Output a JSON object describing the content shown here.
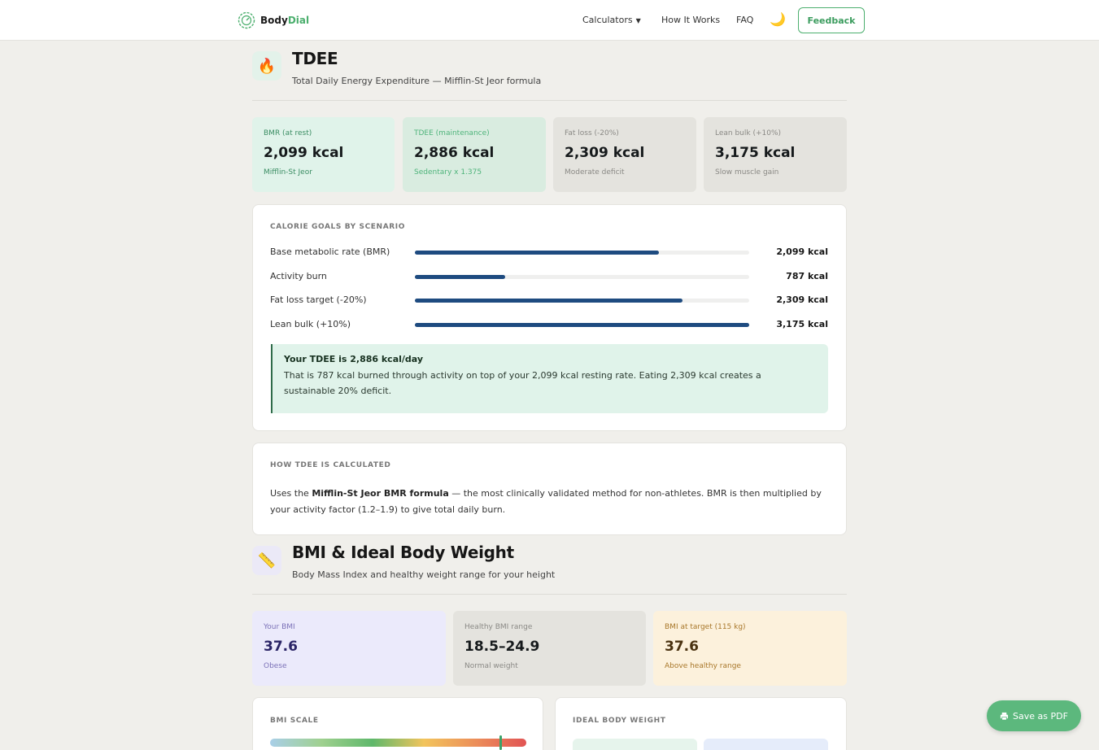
{
  "brand": {
    "name_a": "Body",
    "name_b": "Dial"
  },
  "nav": {
    "calculators": "Calculators",
    "caret": "▼",
    "how": "How It Works",
    "faq": "FAQ",
    "feedback": "Feedback"
  },
  "tdee": {
    "icon": "🔥",
    "title": "TDEE",
    "subtitle": "Total Daily Energy Expenditure — Mifflin-St Jeor formula",
    "stats": [
      {
        "label": "BMR (at rest)",
        "value": "2,099 kcal",
        "note": "Mifflin-St Jeor"
      },
      {
        "label": "TDEE (maintenance)",
        "value": "2,886 kcal",
        "note": "Sedentary x 1.375"
      },
      {
        "label": "Fat loss (-20%)",
        "value": "2,309 kcal",
        "note": "Moderate deficit"
      },
      {
        "label": "Lean bulk (+10%)",
        "value": "3,175 kcal",
        "note": "Slow muscle gain"
      }
    ],
    "goals_title": "CALORIE GOALS BY SCENARIO",
    "goals": [
      {
        "label": "Base metabolic rate (BMR)",
        "value": "2,099 kcal",
        "fraction": 0.73
      },
      {
        "label": "Activity burn",
        "value": "787 kcal",
        "fraction": 0.27
      },
      {
        "label": "Fat loss target (-20%)",
        "value": "2,309 kcal",
        "fraction": 0.8
      },
      {
        "label": "Lean bulk (+10%)",
        "value": "3,175 kcal",
        "fraction": 1.0
      }
    ],
    "callout_title": "Your TDEE is 2,886 kcal/day",
    "callout_body": "That is 787 kcal burned through activity on top of your 2,099 kcal resting rate. Eating 2,309 kcal creates a sustainable 20% deficit.",
    "how_title": "HOW TDEE IS CALCULATED",
    "how_pre": "Uses the ",
    "how_bold": "Mifflin-St Jeor BMR formula",
    "how_post": " — the most clinically validated method for non-athletes. BMR is then multiplied by your activity factor (1.2–1.9) to give total daily burn."
  },
  "bmi": {
    "icon": "📏",
    "title": "BMI & Ideal Body Weight",
    "subtitle": "Body Mass Index and healthy weight range for your height",
    "stats": [
      {
        "label": "Your BMI",
        "value": "37.6",
        "note": "Obese"
      },
      {
        "label": "Healthy BMI range",
        "value": "18.5–24.9",
        "note": "Normal weight"
      },
      {
        "label": "BMI at target (115 kg)",
        "value": "37.6",
        "note": "Above healthy range"
      }
    ],
    "scale_title": "BMI SCALE",
    "ibw_title": "IDEAL BODY WEIGHT"
  },
  "pdf": {
    "icon": "printer-icon",
    "label": "Save as PDF"
  }
}
